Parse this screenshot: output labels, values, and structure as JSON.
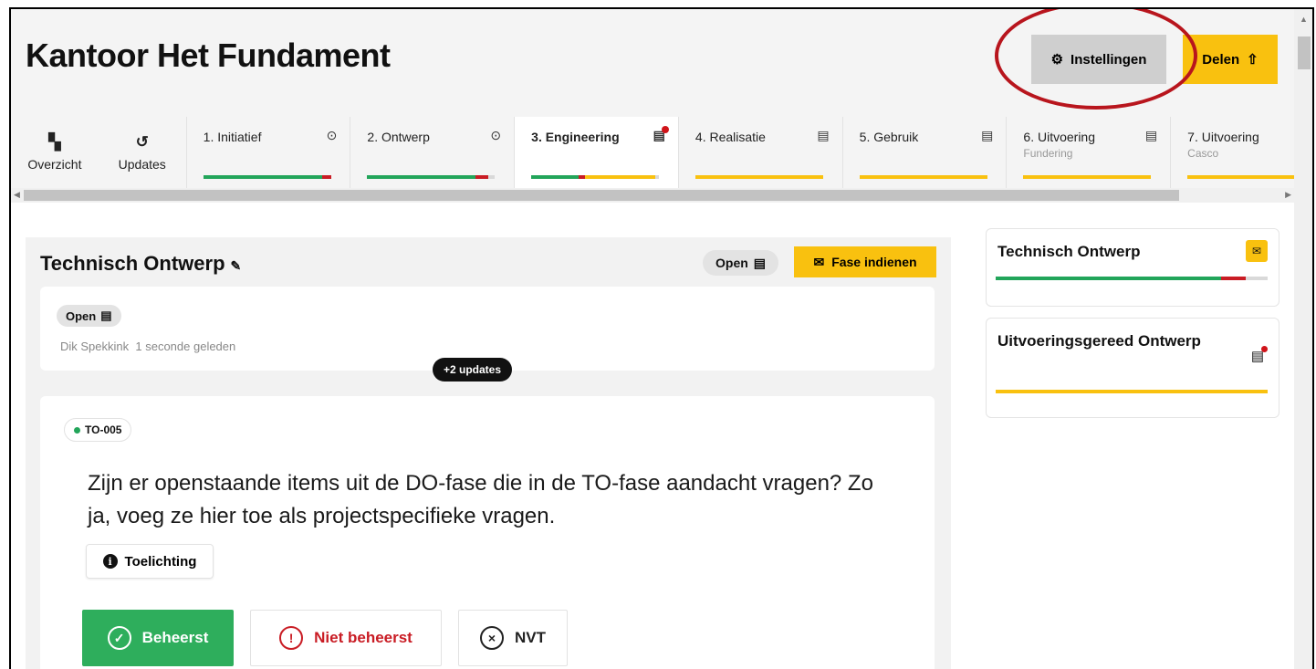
{
  "app": {
    "title": "Kantoor Het Fundament"
  },
  "header": {
    "settings_label": "Instellingen",
    "settings_icon": "gear-icon",
    "share_label": "Delen",
    "share_icon": "share-icon"
  },
  "colors": {
    "accent": "#f9c10f",
    "success": "#2eae5c",
    "danger": "#c91c24",
    "neutral": "#cfcfcf"
  },
  "nav": {
    "overview_label": "Overzicht",
    "overview_icon": "grid-icon",
    "updates_label": "Updates",
    "updates_icon": "history-icon"
  },
  "tabs": [
    {
      "label": "1. Initiatief",
      "sub": "",
      "icon": "check-circle-icon",
      "progress": {
        "green": 0.93,
        "red": 0.07,
        "yellow": 0,
        "grey": 0
      }
    },
    {
      "label": "2. Ontwerp",
      "sub": "",
      "icon": "check-circle-icon",
      "progress": {
        "green": 0.85,
        "red": 0.1,
        "yellow": 0,
        "grey": 0.05
      }
    },
    {
      "label": "3. Engineering",
      "sub": "",
      "icon": "clipboard-icon",
      "progress": {
        "green": 0.37,
        "red": 0.05,
        "yellow": 0.55,
        "grey": 0.03
      }
    },
    {
      "label": "4. Realisatie",
      "sub": "",
      "icon": "clipboard-icon",
      "progress": {
        "green": 0,
        "red": 0,
        "yellow": 1,
        "grey": 0
      }
    },
    {
      "label": "5. Gebruik",
      "sub": "",
      "icon": "clipboard-icon",
      "progress": {
        "green": 0,
        "red": 0,
        "yellow": 1,
        "grey": 0
      }
    },
    {
      "label": "6. Uitvoering",
      "sub": "Fundering",
      "icon": "clipboard-icon",
      "progress": {
        "green": 0,
        "red": 0,
        "yellow": 1,
        "grey": 0
      }
    },
    {
      "label": "7. Uitvoering",
      "sub": "Casco",
      "icon": "",
      "progress": {
        "green": 0,
        "red": 0,
        "yellow": 1,
        "grey": 0
      }
    }
  ],
  "phase": {
    "title": "Technisch Ontwerp",
    "status_label": "Open",
    "submit_label": "Fase indienen"
  },
  "status_card": {
    "status_label": "Open",
    "author": "Dik Spekkink",
    "time": "1 seconde geleden",
    "updates_badge": "+2 updates"
  },
  "question": {
    "code": "TO-005",
    "text": "Zijn er openstaande items uit de DO-fase die in de TO-fase aandacht vragen? Zo ja, voeg ze hier toe als projectspecifieke vragen.",
    "info_label": "Toelichting",
    "choices": {
      "ok": "Beheerst",
      "bad": "Niet beheerst",
      "na": "NVT"
    }
  },
  "sidebar": {
    "cards": [
      {
        "title": "Technisch Ontwerp",
        "progress": {
          "green": 0.83,
          "red": 0.09,
          "yellow": 0,
          "grey": 0.08
        }
      },
      {
        "title": "Uitvoeringsgereed Ontwerp",
        "progress": {
          "green": 0,
          "red": 0,
          "yellow": 1,
          "grey": 0
        }
      }
    ]
  }
}
